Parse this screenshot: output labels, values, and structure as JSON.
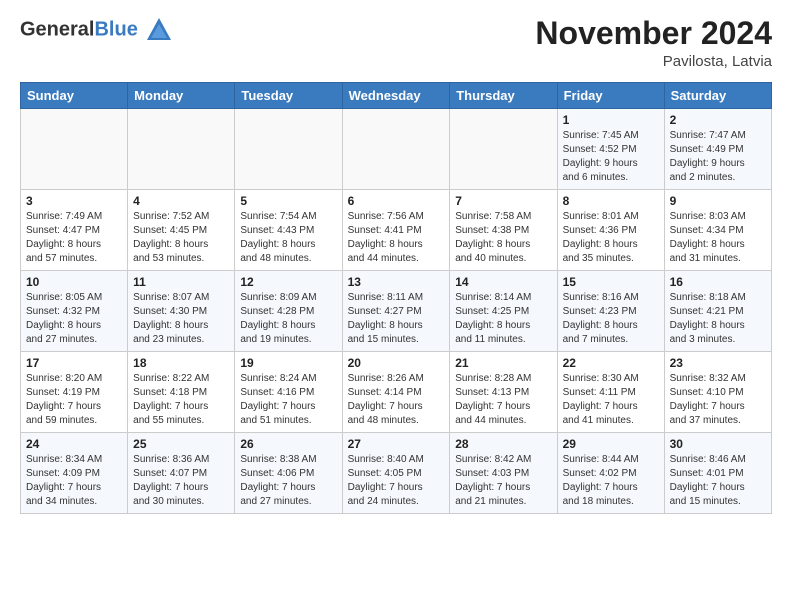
{
  "header": {
    "logo_general": "General",
    "logo_blue": "Blue",
    "month_title": "November 2024",
    "location": "Pavilosta, Latvia"
  },
  "days_of_week": [
    "Sunday",
    "Monday",
    "Tuesday",
    "Wednesday",
    "Thursday",
    "Friday",
    "Saturday"
  ],
  "weeks": [
    [
      {
        "day": "",
        "info": ""
      },
      {
        "day": "",
        "info": ""
      },
      {
        "day": "",
        "info": ""
      },
      {
        "day": "",
        "info": ""
      },
      {
        "day": "",
        "info": ""
      },
      {
        "day": "1",
        "info": "Sunrise: 7:45 AM\nSunset: 4:52 PM\nDaylight: 9 hours\nand 6 minutes."
      },
      {
        "day": "2",
        "info": "Sunrise: 7:47 AM\nSunset: 4:49 PM\nDaylight: 9 hours\nand 2 minutes."
      }
    ],
    [
      {
        "day": "3",
        "info": "Sunrise: 7:49 AM\nSunset: 4:47 PM\nDaylight: 8 hours\nand 57 minutes."
      },
      {
        "day": "4",
        "info": "Sunrise: 7:52 AM\nSunset: 4:45 PM\nDaylight: 8 hours\nand 53 minutes."
      },
      {
        "day": "5",
        "info": "Sunrise: 7:54 AM\nSunset: 4:43 PM\nDaylight: 8 hours\nand 48 minutes."
      },
      {
        "day": "6",
        "info": "Sunrise: 7:56 AM\nSunset: 4:41 PM\nDaylight: 8 hours\nand 44 minutes."
      },
      {
        "day": "7",
        "info": "Sunrise: 7:58 AM\nSunset: 4:38 PM\nDaylight: 8 hours\nand 40 minutes."
      },
      {
        "day": "8",
        "info": "Sunrise: 8:01 AM\nSunset: 4:36 PM\nDaylight: 8 hours\nand 35 minutes."
      },
      {
        "day": "9",
        "info": "Sunrise: 8:03 AM\nSunset: 4:34 PM\nDaylight: 8 hours\nand 31 minutes."
      }
    ],
    [
      {
        "day": "10",
        "info": "Sunrise: 8:05 AM\nSunset: 4:32 PM\nDaylight: 8 hours\nand 27 minutes."
      },
      {
        "day": "11",
        "info": "Sunrise: 8:07 AM\nSunset: 4:30 PM\nDaylight: 8 hours\nand 23 minutes."
      },
      {
        "day": "12",
        "info": "Sunrise: 8:09 AM\nSunset: 4:28 PM\nDaylight: 8 hours\nand 19 minutes."
      },
      {
        "day": "13",
        "info": "Sunrise: 8:11 AM\nSunset: 4:27 PM\nDaylight: 8 hours\nand 15 minutes."
      },
      {
        "day": "14",
        "info": "Sunrise: 8:14 AM\nSunset: 4:25 PM\nDaylight: 8 hours\nand 11 minutes."
      },
      {
        "day": "15",
        "info": "Sunrise: 8:16 AM\nSunset: 4:23 PM\nDaylight: 8 hours\nand 7 minutes."
      },
      {
        "day": "16",
        "info": "Sunrise: 8:18 AM\nSunset: 4:21 PM\nDaylight: 8 hours\nand 3 minutes."
      }
    ],
    [
      {
        "day": "17",
        "info": "Sunrise: 8:20 AM\nSunset: 4:19 PM\nDaylight: 7 hours\nand 59 minutes."
      },
      {
        "day": "18",
        "info": "Sunrise: 8:22 AM\nSunset: 4:18 PM\nDaylight: 7 hours\nand 55 minutes."
      },
      {
        "day": "19",
        "info": "Sunrise: 8:24 AM\nSunset: 4:16 PM\nDaylight: 7 hours\nand 51 minutes."
      },
      {
        "day": "20",
        "info": "Sunrise: 8:26 AM\nSunset: 4:14 PM\nDaylight: 7 hours\nand 48 minutes."
      },
      {
        "day": "21",
        "info": "Sunrise: 8:28 AM\nSunset: 4:13 PM\nDaylight: 7 hours\nand 44 minutes."
      },
      {
        "day": "22",
        "info": "Sunrise: 8:30 AM\nSunset: 4:11 PM\nDaylight: 7 hours\nand 41 minutes."
      },
      {
        "day": "23",
        "info": "Sunrise: 8:32 AM\nSunset: 4:10 PM\nDaylight: 7 hours\nand 37 minutes."
      }
    ],
    [
      {
        "day": "24",
        "info": "Sunrise: 8:34 AM\nSunset: 4:09 PM\nDaylight: 7 hours\nand 34 minutes."
      },
      {
        "day": "25",
        "info": "Sunrise: 8:36 AM\nSunset: 4:07 PM\nDaylight: 7 hours\nand 30 minutes."
      },
      {
        "day": "26",
        "info": "Sunrise: 8:38 AM\nSunset: 4:06 PM\nDaylight: 7 hours\nand 27 minutes."
      },
      {
        "day": "27",
        "info": "Sunrise: 8:40 AM\nSunset: 4:05 PM\nDaylight: 7 hours\nand 24 minutes."
      },
      {
        "day": "28",
        "info": "Sunrise: 8:42 AM\nSunset: 4:03 PM\nDaylight: 7 hours\nand 21 minutes."
      },
      {
        "day": "29",
        "info": "Sunrise: 8:44 AM\nSunset: 4:02 PM\nDaylight: 7 hours\nand 18 minutes."
      },
      {
        "day": "30",
        "info": "Sunrise: 8:46 AM\nSunset: 4:01 PM\nDaylight: 7 hours\nand 15 minutes."
      }
    ]
  ]
}
